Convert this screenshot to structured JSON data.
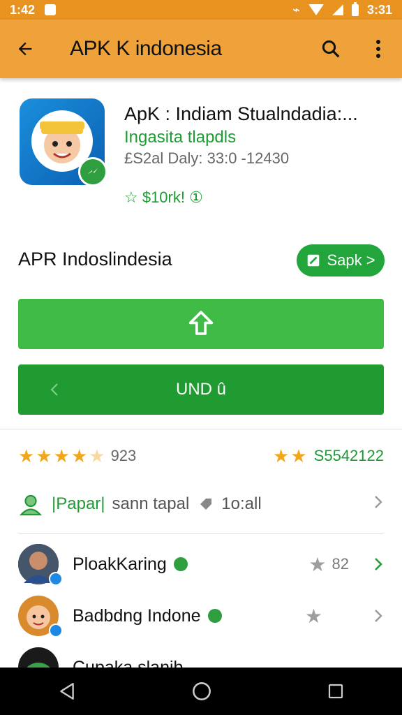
{
  "status_bar": {
    "time": "1:42",
    "right_time": "3:31"
  },
  "app_bar": {
    "title": "APK K indonesia"
  },
  "app": {
    "name": "ApK : Indiam Stualndadia:...",
    "developer": "Ingasita tlapdls",
    "meta": "£S2al Daly: 33:0 -12430",
    "rating_text": "☆ $10rk! ①"
  },
  "section": {
    "title": "APR Indoslindesia",
    "pill_label": "Sapk >"
  },
  "buttons": {
    "primary_icon": "up-arrow-icon",
    "secondary_label": "UND û"
  },
  "ratings": {
    "left_value": "923",
    "right_value": "S5542122"
  },
  "info_row": {
    "label": "|Papar|",
    "sub1": "sann tapal",
    "sub2": "1o:all"
  },
  "list": [
    {
      "name": "PloakKaring",
      "score": "82"
    },
    {
      "name": "Badbdng Indone",
      "score": ""
    },
    {
      "name": "Cupaka slanib",
      "score": ""
    }
  ],
  "colors": {
    "accent": "#f0a23a",
    "green": "#22a53a"
  }
}
